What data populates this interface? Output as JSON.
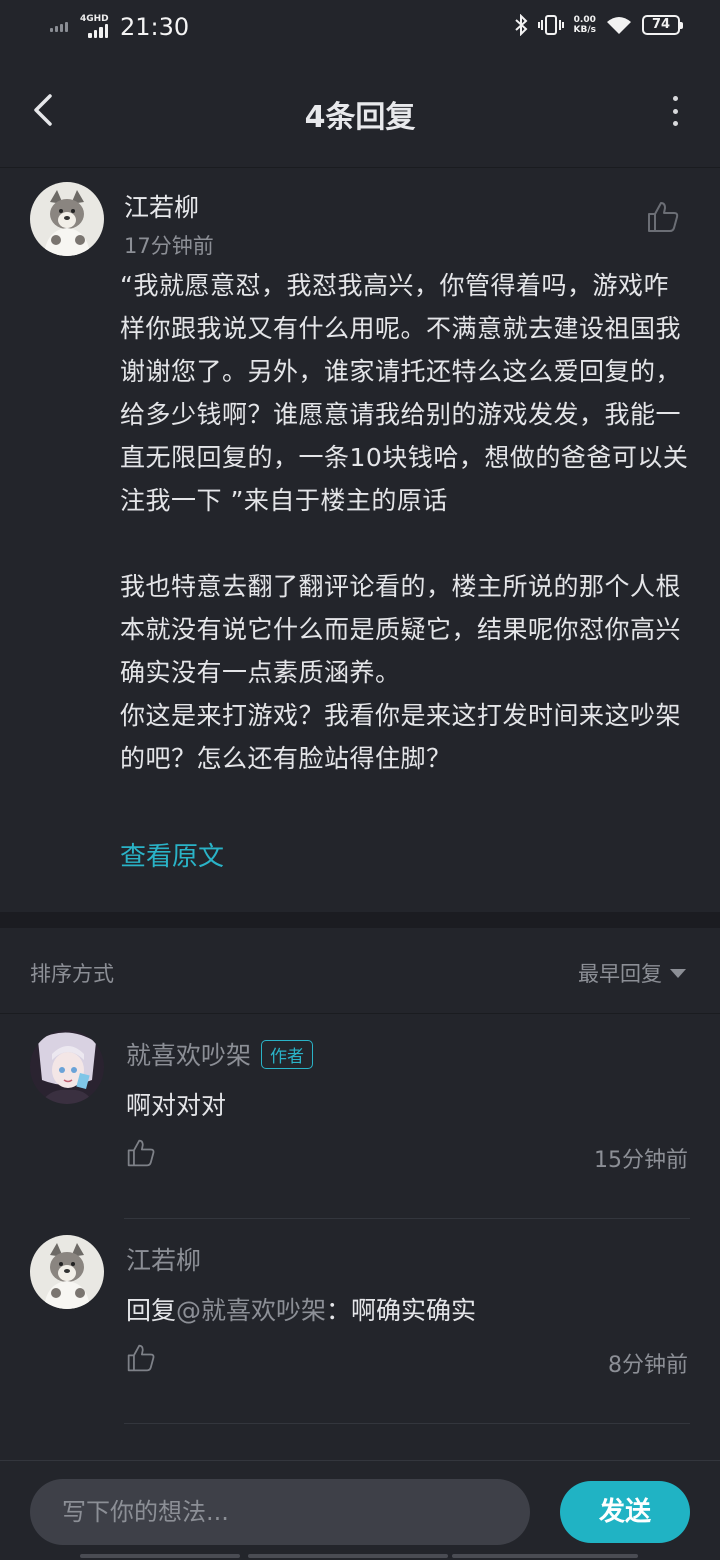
{
  "status_bar": {
    "network": "4GHD",
    "time": "21:30",
    "speed_value": "0.00",
    "speed_unit": "KB/s",
    "battery": "74"
  },
  "header": {
    "title": "4条回复"
  },
  "main_comment": {
    "author": "江若柳",
    "time": "17分钟前",
    "body": "“我就愿意怼，我怼我高兴，你管得着吗，游戏咋样你跟我说又有什么用呢。不满意就去建设祖国我谢谢您了。另外，谁家请托还特么这么爱回复的，给多少钱啊？谁愿意请我给别的游戏发发，我能一直无限回复的，一条10块钱哈，想做的爸爸可以关注我一下 ”来自于楼主的原话\n\n我也特意去翻了翻评论看的，楼主所说的那个人根本就没有说它什么而是质疑它，结果呢你怼你高兴确实没有一点素质涵养。\n你这是来打游戏？我看你是来这打发时间来这吵架的吧？怎么还有脸站得住脚？",
    "view_original": "查看原文"
  },
  "sort": {
    "label": "排序方式",
    "selected": "最早回复"
  },
  "replies": [
    {
      "author": "就喜欢吵架",
      "badge": "作者",
      "text": "啊对对对",
      "time": "15分钟前"
    },
    {
      "author": "江若柳",
      "reply_prefix": "回复",
      "mention": "@就喜欢吵架",
      "colon": "：",
      "text": "啊确实确实",
      "time": "8分钟前"
    }
  ],
  "composer": {
    "placeholder": "写下你的想法...",
    "send_label": "发送"
  },
  "colors": {
    "background": "#23252b",
    "accent": "#20b3c4",
    "muted_text": "#8c8f96"
  }
}
